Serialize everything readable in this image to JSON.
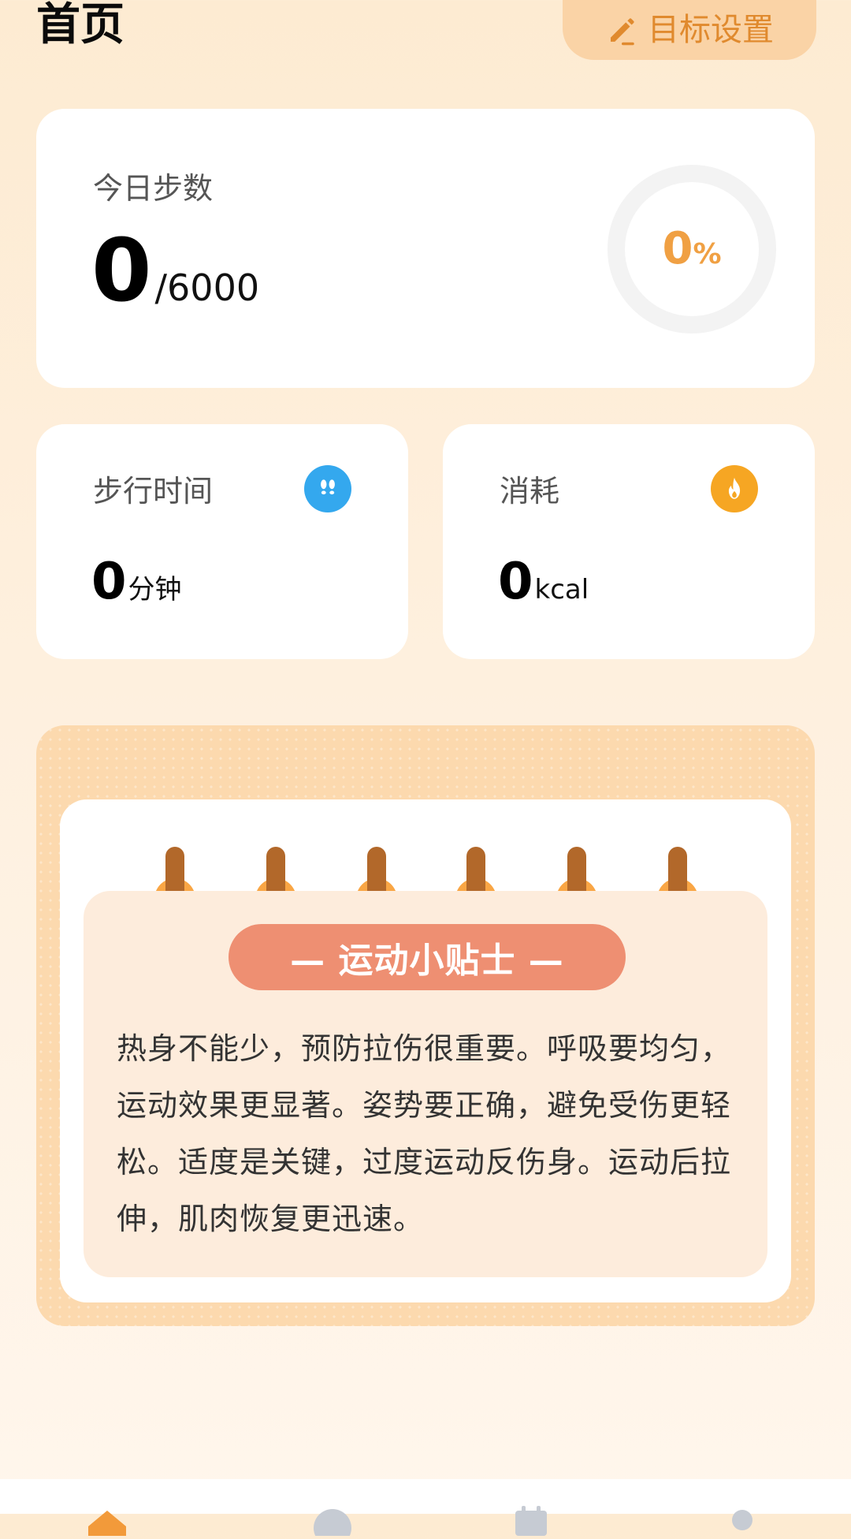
{
  "header": {
    "title": "首页",
    "goal_button_label": "目标设置"
  },
  "steps": {
    "label": "今日步数",
    "count": "0",
    "goal_text": "/6000",
    "progress_value": "0",
    "progress_unit": "%",
    "progress_fraction": 0
  },
  "walk_time": {
    "label": "步行时间",
    "value": "0",
    "unit": "分钟",
    "icon": "footprints-icon"
  },
  "calories": {
    "label": "消耗",
    "value": "0",
    "unit": "kcal",
    "icon": "flame-icon"
  },
  "tips": {
    "title": "— 运动小贴士 —",
    "content": "热身不能少，预防拉伤很重要。呼吸要均匀，运动效果更显著。姿势要正确，避免受伤更轻松。适度是关键，过度运动反伤身。运动后拉伸，肌肉恢复更迅速。"
  },
  "nav": {
    "items": [
      {
        "icon": "home-icon",
        "active": true
      },
      {
        "icon": "compass-icon",
        "active": false
      },
      {
        "icon": "calendar-icon",
        "active": false
      },
      {
        "icon": "profile-icon",
        "active": false
      }
    ]
  },
  "colors": {
    "accent": "#F0A043",
    "goal_button_bg": "#FAD3A6",
    "tips_pill": "#EE8F72",
    "walk_icon_bg": "#34A8EE",
    "burn_icon_bg": "#F6A623",
    "nav_active": "#F29A3A",
    "nav_inactive": "#C6CBD3"
  }
}
